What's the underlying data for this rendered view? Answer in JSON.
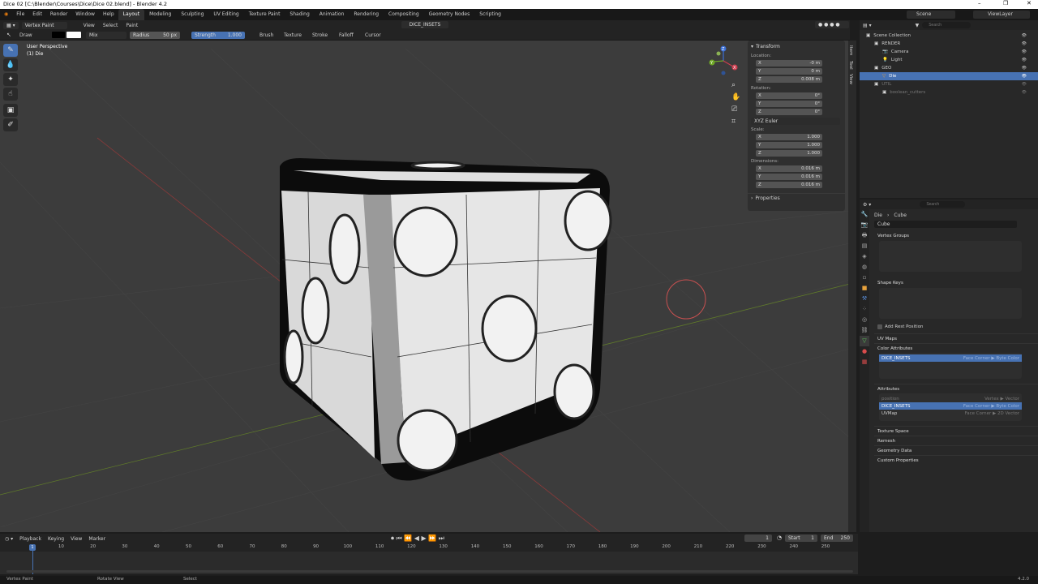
{
  "title": "Dice 02 [C:\\Blender\\Courses\\Dice\\Dice 02.blend] - Blender 4.2",
  "window_controls": [
    "–",
    "❐",
    "✕"
  ],
  "menu": [
    "File",
    "Edit",
    "Render",
    "Window",
    "Help"
  ],
  "workspaces": [
    "Layout",
    "Modeling",
    "Sculpting",
    "UV Editing",
    "Texture Paint",
    "Shading",
    "Animation",
    "Rendering",
    "Compositing",
    "Geometry Nodes",
    "Scripting"
  ],
  "active_workspace": "Layout",
  "scene": "Scene",
  "view_layer": "ViewLayer",
  "viewport_header": {
    "mode": "Vertex Paint",
    "menus": [
      "View",
      "Select",
      "Paint"
    ],
    "attribute": "DICE_INSETS"
  },
  "toolsettings": {
    "brush": "Draw",
    "blend": "Mix",
    "radius_label": "Radius",
    "radius_value": "50 px",
    "strength_label": "Strength",
    "strength_value": "1.000",
    "menus": [
      "Brush",
      "Texture",
      "Stroke",
      "Falloff",
      "Cursor"
    ]
  },
  "viewport_info": {
    "line1": "User Perspective",
    "line2": "(1) Die"
  },
  "nav_gizmo": {
    "x": "X",
    "y": "Y",
    "z": "Z"
  },
  "npanel": {
    "tabs": [
      "Item",
      "Tool",
      "View"
    ],
    "section": "Transform",
    "location_label": "Location:",
    "location": [
      {
        "axis": "X",
        "value": "-0 m"
      },
      {
        "axis": "Y",
        "value": "0 m"
      },
      {
        "axis": "Z",
        "value": "0.008 m"
      }
    ],
    "rotation_label": "Rotation:",
    "rotation": [
      {
        "axis": "X",
        "value": "0°"
      },
      {
        "axis": "Y",
        "value": "0°"
      },
      {
        "axis": "Z",
        "value": "0°"
      }
    ],
    "rotation_mode": "XYZ Euler",
    "scale_label": "Scale:",
    "scale": [
      {
        "axis": "X",
        "value": "1.000"
      },
      {
        "axis": "Y",
        "value": "1.000"
      },
      {
        "axis": "Z",
        "value": "1.000"
      }
    ],
    "dimensions_label": "Dimensions:",
    "dimensions": [
      {
        "axis": "X",
        "value": "0.016 m"
      },
      {
        "axis": "Y",
        "value": "0.016 m"
      },
      {
        "axis": "Z",
        "value": "0.016 m"
      }
    ],
    "properties": "Properties"
  },
  "outliner": {
    "search_placeholder": "Search",
    "items": [
      {
        "label": "Scene Collection",
        "indent": 0,
        "icon": "collection-icon"
      },
      {
        "label": "RENDER",
        "indent": 1,
        "icon": "collection-icon"
      },
      {
        "label": "Camera",
        "indent": 2,
        "icon": "camera-icon"
      },
      {
        "label": "Light",
        "indent": 2,
        "icon": "light-icon"
      },
      {
        "label": "GEO",
        "indent": 1,
        "icon": "collection-icon"
      },
      {
        "label": "Die",
        "indent": 2,
        "icon": "mesh-icon",
        "selected": true
      },
      {
        "label": "UTIL",
        "indent": 1,
        "icon": "collection-icon",
        "dim": true
      },
      {
        "label": "boolean_cutters",
        "indent": 2,
        "icon": "collection-icon",
        "dim": true
      }
    ]
  },
  "properties": {
    "search_placeholder": "Search",
    "object": "Die",
    "mesh": "Cube",
    "mesh_field": "Cube",
    "vertex_groups": "Vertex Groups",
    "shape_keys": "Shape Keys",
    "add_rest_position": "Add Rest Position",
    "uv_maps": "UV Maps",
    "color_attributes": "Color Attributes",
    "color_attr_item": {
      "name": "DICE_INSETS",
      "domain": "Face Corner ▶ Byte Color"
    },
    "attributes": "Attributes",
    "attribute_items": [
      {
        "name": "position",
        "domain": "Vertex ▶ Vector",
        "dim": true
      },
      {
        "name": "DICE_INSETS",
        "domain": "Face Corner ▶ Byte Color",
        "selected": true
      },
      {
        "name": "UVMap",
        "domain": "Face Corner ▶ 2D Vector"
      }
    ],
    "sections": [
      "Texture Space",
      "Remesh",
      "Geometry Data",
      "Custom Properties"
    ]
  },
  "timeline": {
    "menus": [
      "Playback",
      "Keying",
      "View",
      "Marker"
    ],
    "current_frame": "1",
    "start_label": "Start",
    "start": "1",
    "end_label": "End",
    "end": "250",
    "ticks": [
      "1",
      "10",
      "20",
      "30",
      "40",
      "50",
      "60",
      "70",
      "80",
      "90",
      "100",
      "110",
      "120",
      "130",
      "140",
      "150",
      "160",
      "170",
      "180",
      "190",
      "200",
      "210",
      "220",
      "230",
      "240",
      "250"
    ]
  },
  "statusbar": {
    "items": [
      "Vertex Paint",
      "Rotate View",
      "Select"
    ],
    "version": "4.2.0"
  }
}
